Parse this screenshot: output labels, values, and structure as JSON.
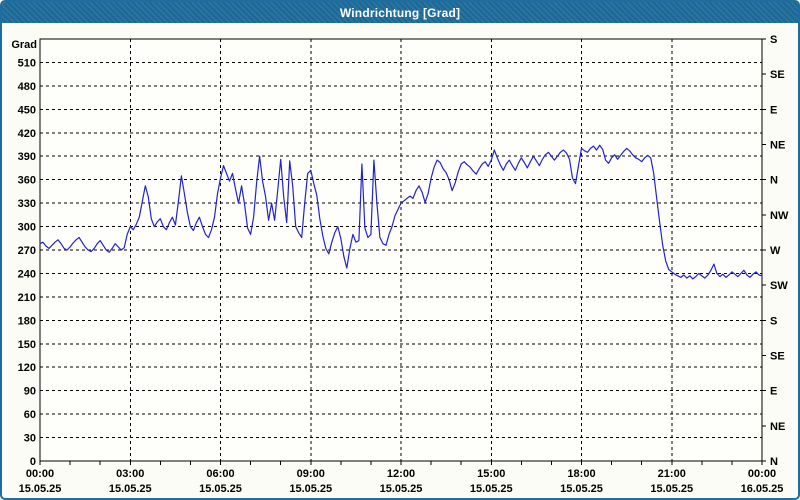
{
  "window": {
    "title": "Windrichtung [Grad]"
  },
  "colors": {
    "titlebar": "#1f6d9e",
    "border": "#1f6d9e",
    "window_bg": "#fcfcf6",
    "plot_bg": "#fefefb",
    "line": "#2323cd",
    "grid": "#000000",
    "frame": "#000000",
    "title_text": "#ffffff",
    "label_text": "#000000"
  },
  "chart_data": {
    "type": "line",
    "title": "Windrichtung [Grad]",
    "ylabel_left": "Grad",
    "grid": true,
    "xlim_hours": [
      0,
      24
    ],
    "ylim": [
      0,
      540
    ],
    "left_tick_step": 30,
    "left_tick_labels": [
      "0",
      "30",
      "60",
      "90",
      "120",
      "150",
      "180",
      "210",
      "240",
      "270",
      "300",
      "330",
      "360",
      "390",
      "420",
      "450",
      "480",
      "510"
    ],
    "right_ticks": [
      {
        "deg": 540,
        "label": "S"
      },
      {
        "deg": 495,
        "label": "SE"
      },
      {
        "deg": 450,
        "label": "E"
      },
      {
        "deg": 405,
        "label": "NE"
      },
      {
        "deg": 360,
        "label": "N"
      },
      {
        "deg": 315,
        "label": "NW"
      },
      {
        "deg": 270,
        "label": "W"
      },
      {
        "deg": 225,
        "label": "SW"
      },
      {
        "deg": 180,
        "label": "S"
      },
      {
        "deg": 135,
        "label": "SE"
      },
      {
        "deg": 90,
        "label": "E"
      },
      {
        "deg": 45,
        "label": "NE"
      },
      {
        "deg": 0,
        "label": "N"
      }
    ],
    "x_major_ticks": [
      {
        "hour": 0,
        "time": "00:00",
        "date": "15.05.25"
      },
      {
        "hour": 3,
        "time": "03:00",
        "date": "15.05.25"
      },
      {
        "hour": 6,
        "time": "06:00",
        "date": "15.05.25"
      },
      {
        "hour": 9,
        "time": "09:00",
        "date": "15.05.25"
      },
      {
        "hour": 12,
        "time": "12:00",
        "date": "15.05.25"
      },
      {
        "hour": 15,
        "time": "15:00",
        "date": "15.05.25"
      },
      {
        "hour": 18,
        "time": "18:00",
        "date": "15.05.25"
      },
      {
        "hour": 21,
        "time": "21:00",
        "date": "15.05.25"
      },
      {
        "hour": 24,
        "time": "00:00",
        "date": "16.05.25"
      }
    ],
    "x_minor_step_hours": 1,
    "series": [
      {
        "name": "Windrichtung",
        "points": [
          [
            0,
            278
          ],
          [
            0.1,
            280
          ],
          [
            0.2,
            275
          ],
          [
            0.3,
            272
          ],
          [
            0.4,
            276
          ],
          [
            0.5,
            280
          ],
          [
            0.6,
            283
          ],
          [
            0.7,
            278
          ],
          [
            0.8,
            272
          ],
          [
            0.9,
            270
          ],
          [
            1,
            274
          ],
          [
            1.1,
            279
          ],
          [
            1.2,
            283
          ],
          [
            1.3,
            286
          ],
          [
            1.4,
            280
          ],
          [
            1.5,
            274
          ],
          [
            1.6,
            270
          ],
          [
            1.7,
            268
          ],
          [
            1.8,
            272
          ],
          [
            1.9,
            278
          ],
          [
            2,
            282
          ],
          [
            2.1,
            276
          ],
          [
            2.2,
            270
          ],
          [
            2.3,
            267
          ],
          [
            2.4,
            272
          ],
          [
            2.5,
            278
          ],
          [
            2.6,
            274
          ],
          [
            2.7,
            270
          ],
          [
            2.8,
            273
          ],
          [
            2.9,
            290
          ],
          [
            3,
            300
          ],
          [
            3.1,
            296
          ],
          [
            3.2,
            303
          ],
          [
            3.3,
            312
          ],
          [
            3.4,
            332
          ],
          [
            3.5,
            352
          ],
          [
            3.6,
            338
          ],
          [
            3.7,
            310
          ],
          [
            3.8,
            300
          ],
          [
            3.9,
            306
          ],
          [
            4,
            310
          ],
          [
            4.1,
            300
          ],
          [
            4.2,
            296
          ],
          [
            4.3,
            305
          ],
          [
            4.4,
            312
          ],
          [
            4.5,
            302
          ],
          [
            4.6,
            332
          ],
          [
            4.7,
            365
          ],
          [
            4.8,
            342
          ],
          [
            4.9,
            318
          ],
          [
            5,
            300
          ],
          [
            5.1,
            295
          ],
          [
            5.2,
            305
          ],
          [
            5.3,
            312
          ],
          [
            5.4,
            300
          ],
          [
            5.5,
            290
          ],
          [
            5.6,
            286
          ],
          [
            5.7,
            296
          ],
          [
            5.8,
            312
          ],
          [
            5.9,
            342
          ],
          [
            6,
            362
          ],
          [
            6.1,
            378
          ],
          [
            6.2,
            368
          ],
          [
            6.3,
            358
          ],
          [
            6.4,
            368
          ],
          [
            6.5,
            348
          ],
          [
            6.6,
            330
          ],
          [
            6.7,
            352
          ],
          [
            6.8,
            328
          ],
          [
            6.9,
            298
          ],
          [
            7,
            290
          ],
          [
            7.1,
            312
          ],
          [
            7.2,
            356
          ],
          [
            7.3,
            390
          ],
          [
            7.4,
            358
          ],
          [
            7.5,
            338
          ],
          [
            7.6,
            308
          ],
          [
            7.7,
            330
          ],
          [
            7.8,
            308
          ],
          [
            7.9,
            346
          ],
          [
            8,
            386
          ],
          [
            8.1,
            338
          ],
          [
            8.2,
            305
          ],
          [
            8.3,
            384
          ],
          [
            8.4,
            352
          ],
          [
            8.5,
            300
          ],
          [
            8.6,
            292
          ],
          [
            8.7,
            286
          ],
          [
            8.8,
            330
          ],
          [
            8.9,
            368
          ],
          [
            9,
            372
          ],
          [
            9.1,
            355
          ],
          [
            9.2,
            340
          ],
          [
            9.3,
            310
          ],
          [
            9.4,
            288
          ],
          [
            9.5,
            272
          ],
          [
            9.6,
            265
          ],
          [
            9.7,
            280
          ],
          [
            9.8,
            292
          ],
          [
            9.9,
            300
          ],
          [
            10,
            285
          ],
          [
            10.1,
            262
          ],
          [
            10.2,
            247
          ],
          [
            10.3,
            272
          ],
          [
            10.4,
            290
          ],
          [
            10.5,
            280
          ],
          [
            10.6,
            282
          ],
          [
            10.7,
            380
          ],
          [
            10.8,
            298
          ],
          [
            10.9,
            286
          ],
          [
            11,
            290
          ],
          [
            11.1,
            385
          ],
          [
            11.2,
            330
          ],
          [
            11.3,
            286
          ],
          [
            11.4,
            278
          ],
          [
            11.5,
            276
          ],
          [
            11.6,
            290
          ],
          [
            11.7,
            300
          ],
          [
            11.8,
            314
          ],
          [
            11.9,
            322
          ],
          [
            12,
            330
          ],
          [
            12.1,
            333
          ],
          [
            12.2,
            336
          ],
          [
            12.3,
            339
          ],
          [
            12.4,
            336
          ],
          [
            12.5,
            346
          ],
          [
            12.6,
            352
          ],
          [
            12.7,
            344
          ],
          [
            12.8,
            331
          ],
          [
            12.9,
            342
          ],
          [
            13,
            362
          ],
          [
            13.1,
            376
          ],
          [
            13.2,
            385
          ],
          [
            13.3,
            382
          ],
          [
            13.4,
            374
          ],
          [
            13.5,
            369
          ],
          [
            13.6,
            360
          ],
          [
            13.7,
            346
          ],
          [
            13.8,
            356
          ],
          [
            13.9,
            370
          ],
          [
            14,
            380
          ],
          [
            14.1,
            383
          ],
          [
            14.2,
            379
          ],
          [
            14.3,
            376
          ],
          [
            14.4,
            371
          ],
          [
            14.5,
            367
          ],
          [
            14.6,
            374
          ],
          [
            14.7,
            380
          ],
          [
            14.8,
            383
          ],
          [
            14.9,
            377
          ],
          [
            15,
            385
          ],
          [
            15.1,
            398
          ],
          [
            15.2,
            388
          ],
          [
            15.3,
            379
          ],
          [
            15.4,
            372
          ],
          [
            15.5,
            380
          ],
          [
            15.6,
            385
          ],
          [
            15.7,
            378
          ],
          [
            15.8,
            372
          ],
          [
            15.9,
            381
          ],
          [
            16,
            388
          ],
          [
            16.1,
            382
          ],
          [
            16.2,
            375
          ],
          [
            16.3,
            383
          ],
          [
            16.4,
            390
          ],
          [
            16.5,
            384
          ],
          [
            16.6,
            378
          ],
          [
            16.7,
            386
          ],
          [
            16.8,
            392
          ],
          [
            16.9,
            395
          ],
          [
            17,
            390
          ],
          [
            17.1,
            385
          ],
          [
            17.2,
            390
          ],
          [
            17.3,
            395
          ],
          [
            17.4,
            398
          ],
          [
            17.5,
            394
          ],
          [
            17.6,
            386
          ],
          [
            17.7,
            362
          ],
          [
            17.8,
            355
          ],
          [
            17.9,
            378
          ],
          [
            18,
            400
          ],
          [
            18.1,
            397
          ],
          [
            18.2,
            395
          ],
          [
            18.3,
            400
          ],
          [
            18.4,
            403
          ],
          [
            18.5,
            398
          ],
          [
            18.6,
            404
          ],
          [
            18.7,
            399
          ],
          [
            18.8,
            385
          ],
          [
            18.9,
            381
          ],
          [
            19,
            388
          ],
          [
            19.1,
            392
          ],
          [
            19.2,
            386
          ],
          [
            19.3,
            391
          ],
          [
            19.4,
            396
          ],
          [
            19.5,
            400
          ],
          [
            19.6,
            397
          ],
          [
            19.7,
            392
          ],
          [
            19.8,
            388
          ],
          [
            19.9,
            386
          ],
          [
            20,
            383
          ],
          [
            20.1,
            388
          ],
          [
            20.2,
            391
          ],
          [
            20.3,
            388
          ],
          [
            20.4,
            368
          ],
          [
            20.5,
            336
          ],
          [
            20.6,
            305
          ],
          [
            20.7,
            276
          ],
          [
            20.8,
            256
          ],
          [
            20.9,
            245
          ],
          [
            21,
            242
          ],
          [
            21.1,
            239
          ],
          [
            21.2,
            237
          ],
          [
            21.3,
            235
          ],
          [
            21.4,
            238
          ],
          [
            21.5,
            234
          ],
          [
            21.6,
            237
          ],
          [
            21.7,
            233
          ],
          [
            21.8,
            236
          ],
          [
            21.9,
            240
          ],
          [
            22,
            237
          ],
          [
            22.1,
            234
          ],
          [
            22.2,
            238
          ],
          [
            22.3,
            244
          ],
          [
            22.4,
            252
          ],
          [
            22.5,
            240
          ],
          [
            22.6,
            236
          ],
          [
            22.7,
            239
          ],
          [
            22.8,
            235
          ],
          [
            22.9,
            238
          ],
          [
            23,
            242
          ],
          [
            23.1,
            239
          ],
          [
            23.2,
            236
          ],
          [
            23.3,
            240
          ],
          [
            23.4,
            244
          ],
          [
            23.5,
            238
          ],
          [
            23.6,
            235
          ],
          [
            23.7,
            239
          ],
          [
            23.8,
            242
          ],
          [
            23.9,
            238
          ],
          [
            24,
            237
          ]
        ]
      }
    ]
  }
}
